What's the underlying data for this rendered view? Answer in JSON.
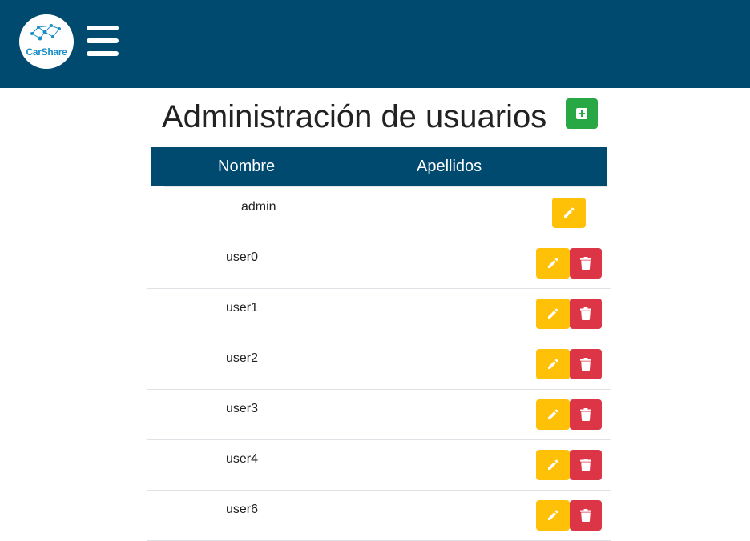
{
  "app": {
    "logo_text": "CarShare"
  },
  "page": {
    "title": "Administración de usuarios"
  },
  "table": {
    "headers": [
      "Nombre",
      "Apellidos"
    ],
    "rows": [
      {
        "nombre": "admin",
        "apellidos": "",
        "can_delete": false
      },
      {
        "nombre": "user0",
        "apellidos": "",
        "can_delete": true
      },
      {
        "nombre": "user1",
        "apellidos": "",
        "can_delete": true
      },
      {
        "nombre": "user2",
        "apellidos": "",
        "can_delete": true
      },
      {
        "nombre": "user3",
        "apellidos": "",
        "can_delete": true
      },
      {
        "nombre": "user4",
        "apellidos": "",
        "can_delete": true
      },
      {
        "nombre": "user6",
        "apellidos": "",
        "can_delete": true
      }
    ]
  },
  "icons": {
    "menu": "hamburger-icon",
    "add": "plus-square-icon",
    "edit": "pencil-icon",
    "delete": "trash-icon"
  },
  "colors": {
    "header_bg": "#004a70",
    "add": "#28a745",
    "edit": "#ffc107",
    "delete": "#dc3545"
  }
}
